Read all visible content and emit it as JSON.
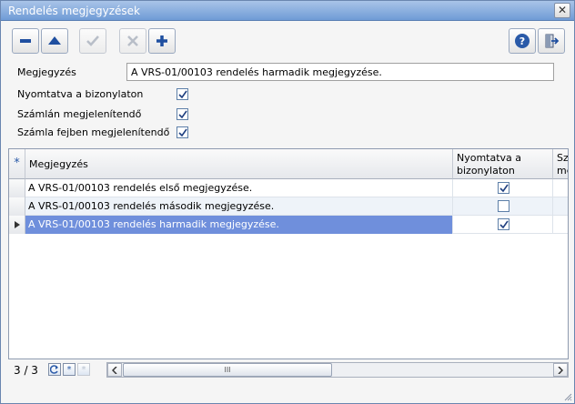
{
  "window": {
    "title": "Rendelés megjegyzések",
    "close_glyph": "✕"
  },
  "toolbar": {
    "buttons": [
      {
        "name": "delete-button",
        "icon": "minus-icon",
        "enabled": true
      },
      {
        "name": "move-up-button",
        "icon": "triangle-up-icon",
        "enabled": true
      },
      {
        "name": "confirm-button",
        "icon": "check-icon",
        "enabled": false
      },
      {
        "name": "cancel-button",
        "icon": "x-icon",
        "enabled": false
      },
      {
        "name": "add-button",
        "icon": "plus-icon",
        "enabled": true
      },
      {
        "name": "help-button",
        "icon": "question-icon",
        "enabled": true
      },
      {
        "name": "exit-button",
        "icon": "exit-door-icon",
        "enabled": true
      }
    ]
  },
  "form": {
    "note_label": "Megjegyzés",
    "note_value": "A VRS-01/00103 rendelés harmadik megjegyzése.",
    "printed_label": "Nyomtatva a bizonylaton",
    "printed_checked": true,
    "invoice_label": "Számlán megjelenítendő",
    "invoice_checked": true,
    "invoice_header_label": "Számla fejben megjelenítendő",
    "invoice_header_checked": true
  },
  "grid": {
    "new_row_glyph": "*",
    "columns": [
      "Megjegyzés",
      "Nyomtatva a bizonylaton",
      "Sza me"
    ],
    "col1_line1": "Nyomtatva a",
    "col1_line2": "bizonylaton",
    "col2_line1": "Sza",
    "col2_line2": "me",
    "rows": [
      {
        "text": "A VRS-01/00103 rendelés első megjegyzése.",
        "printed": true
      },
      {
        "text": "A VRS-01/00103 rendelés második megjegyzése.",
        "printed": false
      },
      {
        "text": "A VRS-01/00103 rendelés harmadik megjegyzése.",
        "printed": true,
        "selected": true
      }
    ]
  },
  "footer": {
    "pager": "3 / 3",
    "scroll_thumb_glyph": "III"
  },
  "colors": {
    "selection": "#6f8fdc",
    "titlebar": "#6f9bd6",
    "accent": "#2a5aa8"
  }
}
